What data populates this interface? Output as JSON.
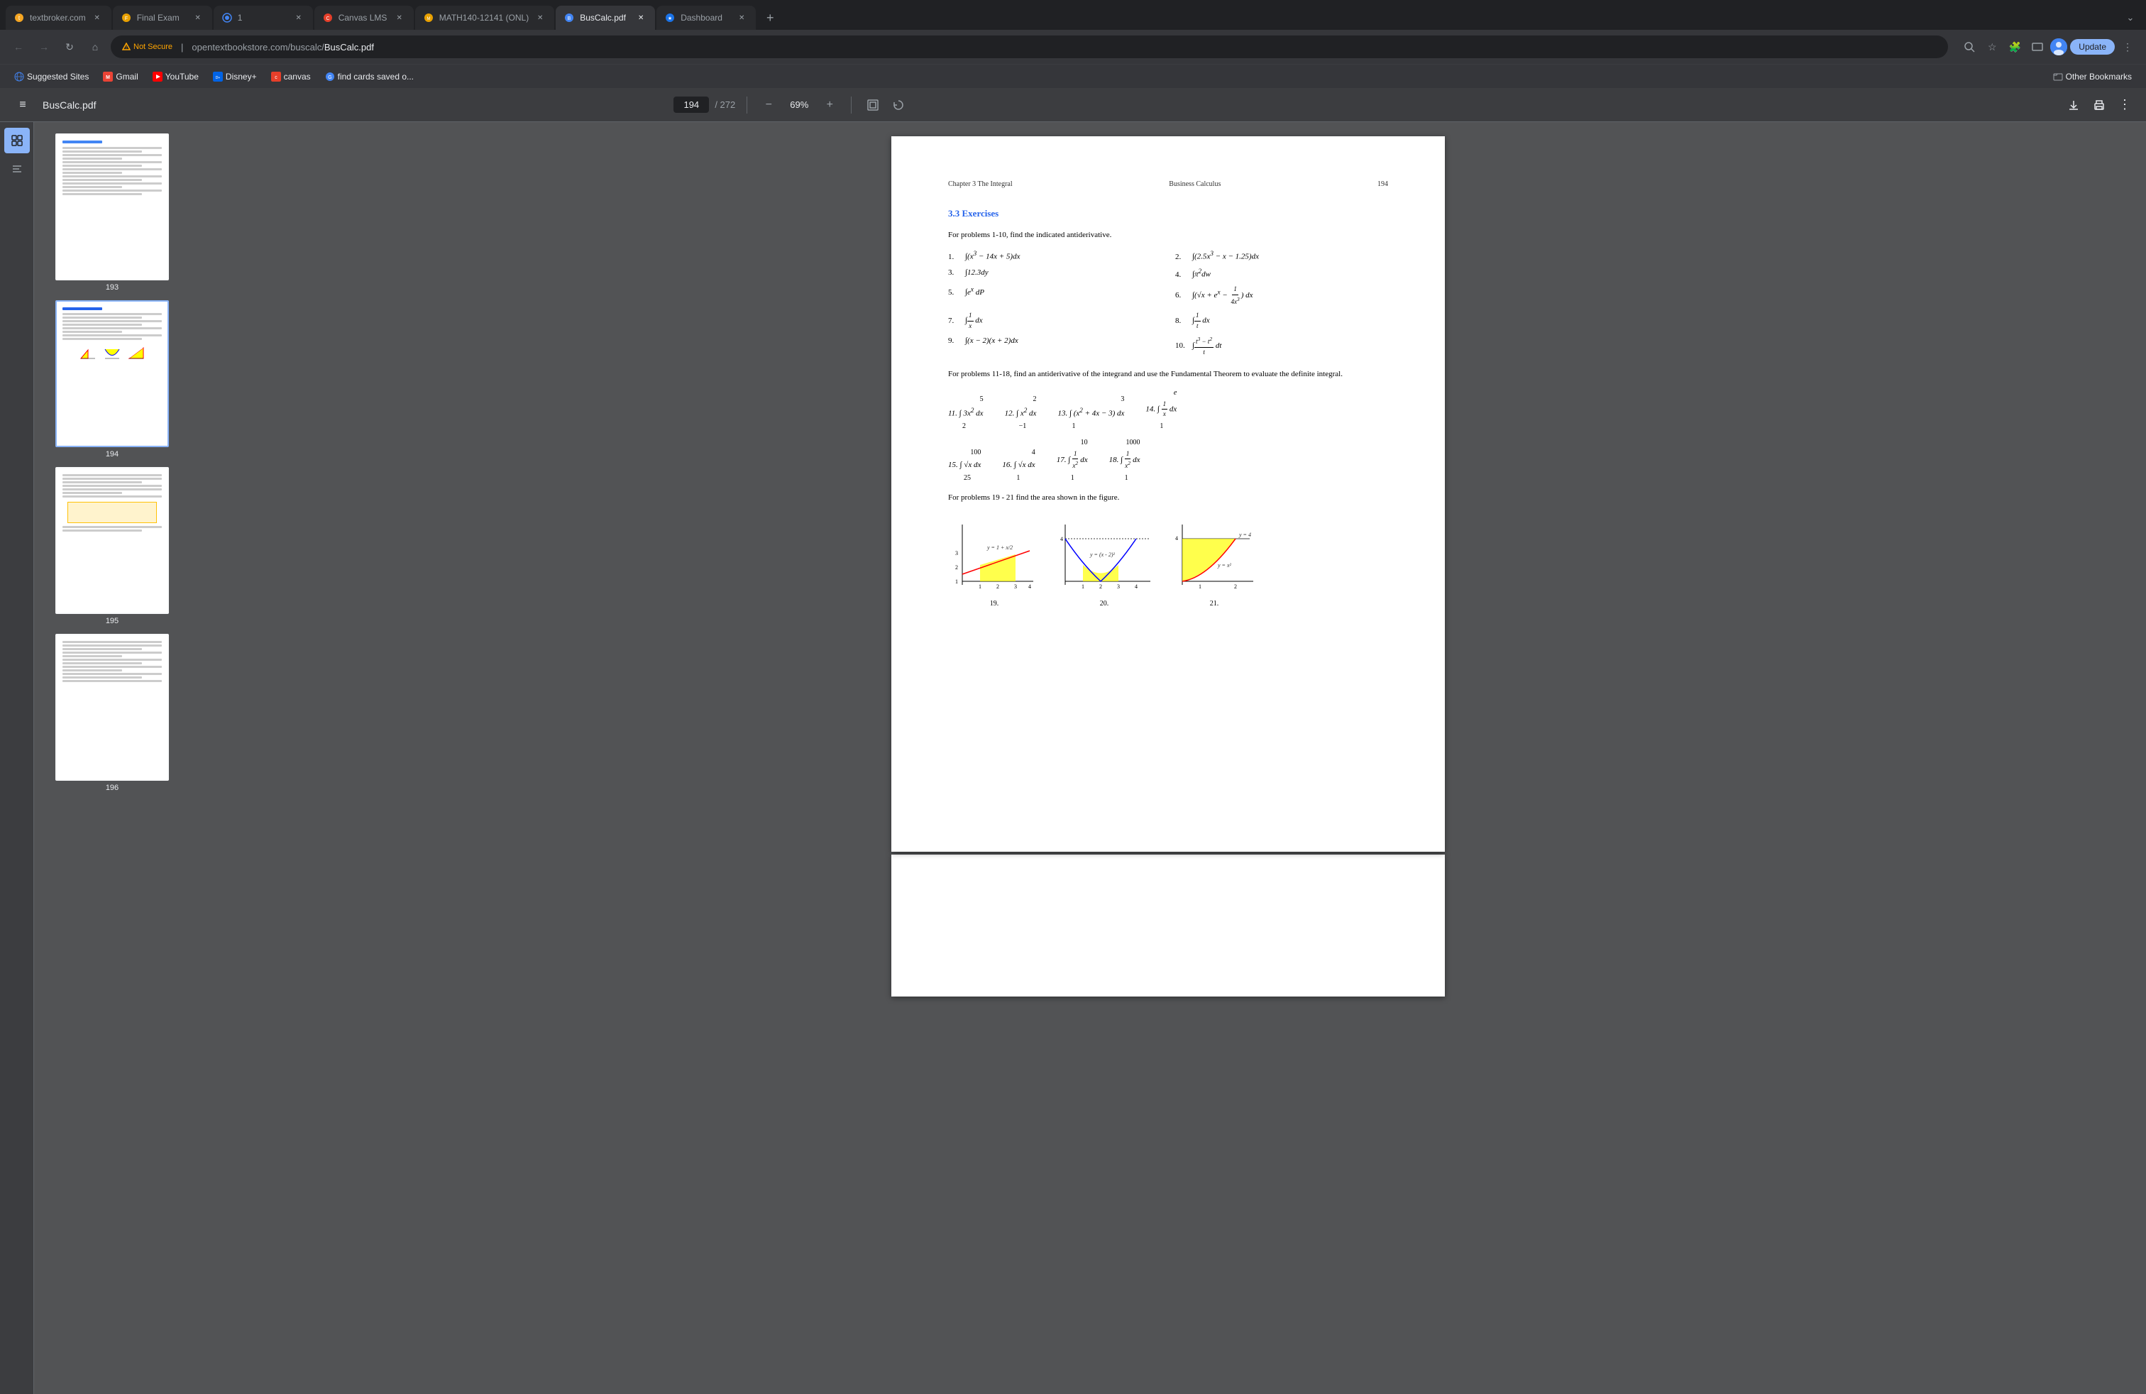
{
  "browser": {
    "tabs": [
      {
        "id": "tab1",
        "title": "textbroker.com",
        "favicon": "globe",
        "active": false,
        "favicon_color": "#f5a623"
      },
      {
        "id": "tab2",
        "title": "Final Exam",
        "favicon": "graduation",
        "active": false,
        "favicon_color": "#e8a000"
      },
      {
        "id": "tab3",
        "title": "1",
        "favicon": "globe-blue",
        "active": false,
        "favicon_color": "#4285f4"
      },
      {
        "id": "tab4",
        "title": "Canvas LMS",
        "favicon": "canvas",
        "active": false,
        "favicon_color": "#e63f2a"
      },
      {
        "id": "tab5",
        "title": "MATH140-12141 (ONL)",
        "favicon": "math",
        "active": false,
        "favicon_color": "#e8a000"
      },
      {
        "id": "tab6",
        "title": "BusCalc.pdf",
        "favicon": "pdf",
        "active": true,
        "favicon_color": "#4285f4"
      },
      {
        "id": "tab7",
        "title": "Dashboard",
        "favicon": "star",
        "active": false,
        "favicon_color": "#1a73e8"
      }
    ],
    "address_bar": {
      "security": "Not Secure",
      "url_prefix": "opentextbookstore.com/buscalc/",
      "url_main": "BusCalc.pdf"
    },
    "bookmarks": [
      {
        "label": "Suggested Sites",
        "favicon": "globe"
      },
      {
        "label": "Gmail",
        "favicon": "gmail",
        "color": "#ea4335"
      },
      {
        "label": "YouTube",
        "favicon": "youtube",
        "color": "#ff0000"
      },
      {
        "label": "Disney+",
        "favicon": "disney",
        "color": "#0063e5"
      },
      {
        "label": "canvas",
        "favicon": "canvas2",
        "color": "#e63f2a"
      },
      {
        "label": "find cards saved o...",
        "favicon": "google",
        "color": "#4285f4"
      }
    ],
    "other_bookmarks": "Other Bookmarks"
  },
  "pdf_toolbar": {
    "title": "BusCalc.pdf",
    "current_page": "194",
    "total_pages": "272",
    "zoom": "69%",
    "menu_icon": "≡",
    "download_icon": "⬇",
    "print_icon": "🖶",
    "more_icon": "⋮"
  },
  "thumbnails": [
    {
      "num": "193",
      "active": false
    },
    {
      "num": "194",
      "active": true
    },
    {
      "num": "195",
      "active": false
    },
    {
      "num": "196",
      "active": false
    }
  ],
  "pdf_page": {
    "header_left": "Chapter 3   The Integral",
    "header_center": "Business Calculus",
    "header_right": "194",
    "section_title": "3.3 Exercises",
    "instruction1": "For problems  1-10, find the indicated antiderivative.",
    "problems_basic": [
      {
        "num": "1.",
        "expr": "∫(x³ − 14x + 5)dx"
      },
      {
        "num": "2.",
        "expr": "∫(2.5x³ − x − 1.25)dx"
      },
      {
        "num": "3.",
        "expr": "∫12.3dy"
      },
      {
        "num": "4.",
        "expr": "∫π²dw"
      },
      {
        "num": "5.",
        "expr": "∫eˣ dP"
      },
      {
        "num": "6.",
        "expr": "∫(√x + eˣ − 1/(4x³)) dx"
      },
      {
        "num": "7.",
        "expr": "∫(1/x) dx"
      },
      {
        "num": "8.",
        "expr": "∫(1/t) dx"
      },
      {
        "num": "9.",
        "expr": "∫(x − 2)(x + 2)dx"
      },
      {
        "num": "10.",
        "expr": "∫(t³ − t²)/t dt"
      }
    ],
    "instruction2": "For problems 11-18, find an antiderivative of the integrand and use the Fundamental Theorem to evaluate the definite integral.",
    "problems_definite": [
      {
        "num": "11.",
        "expr": "∫₂⁵ 3x² dx"
      },
      {
        "num": "12.",
        "expr": "∫₋₁² x² dx"
      },
      {
        "num": "13.",
        "expr": "∫₁³ (x² + 4x − 3) dx"
      },
      {
        "num": "14.",
        "expr": "∫₁ᵉ (1/x) dx"
      },
      {
        "num": "15.",
        "expr": "∫₂₅¹⁰⁰ √x dx"
      },
      {
        "num": "16.",
        "expr": "∫₁⁴ √x dx"
      },
      {
        "num": "17.",
        "expr": "∫₁¹⁰ (1/x²) dx"
      },
      {
        "num": "18.",
        "expr": "∫₁¹⁰⁰⁰ (1/x²) dx"
      }
    ],
    "instruction3": "For problems 19 - 21 find the area shown in the figure.",
    "graphs": [
      {
        "num": "19.",
        "label": "y = 1 + x/2"
      },
      {
        "num": "20.",
        "label": "y = (x - 2)²"
      },
      {
        "num": "21.",
        "label": "y = x²; y = 4"
      }
    ]
  }
}
